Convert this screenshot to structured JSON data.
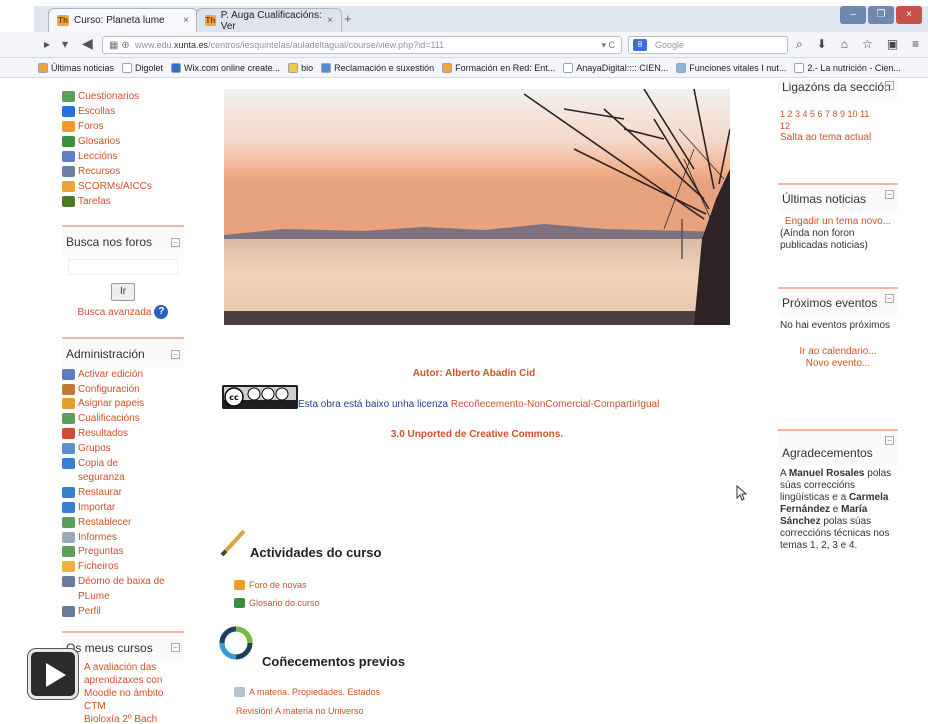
{
  "browser": {
    "tabs": [
      {
        "label": "Curso: Planeta lume",
        "active": true
      },
      {
        "label": "P. Auga Cualificacións: Ver",
        "active": false
      }
    ],
    "new_tab": "+",
    "window_buttons": [
      "–",
      "❐",
      "×"
    ],
    "url_prefix": "www.edu.",
    "url_host": "xunta.es",
    "url_path": "/centros/iesquintelas/auladeltagual/course/view.php?id=111",
    "search_placeholder": "Google",
    "bookmarks": [
      {
        "label": "Últimas noticias",
        "color": "#f0a53a"
      },
      {
        "label": "Digolet",
        "color": "#ffffff"
      },
      {
        "label": "Wix.com online create...",
        "color": "#2f6fd0"
      },
      {
        "label": "bio",
        "color": "#f2c94c"
      },
      {
        "label": "Reclamación e suxestión",
        "color": "#4a90d9"
      },
      {
        "label": "Formación en Red: Ent...",
        "color": "#f0a53a"
      },
      {
        "label": "AnayaDigital:::: CIEN...",
        "color": "#ffffff"
      },
      {
        "label": "Funciones vitales I nut...",
        "color": "#8fb3e0"
      },
      {
        "label": "2.- La nutrición - Cien...",
        "color": "#ffffff"
      }
    ]
  },
  "left": {
    "activities": [
      {
        "label": "Cuestionarios",
        "color": "#5aa05a"
      },
      {
        "label": "Escollas",
        "color": "#2a6fd6"
      },
      {
        "label": "Foros",
        "color": "#f09a2b"
      },
      {
        "label": "Glosarios",
        "color": "#3d8f3d"
      },
      {
        "label": "Leccións",
        "color": "#5b7fc9"
      },
      {
        "label": "Recursos",
        "color": "#6b7fa8"
      },
      {
        "label": "SCORMs/AICCs",
        "color": "#e8a63a"
      },
      {
        "label": "Tarefas",
        "color": "#4a7a2a"
      }
    ],
    "search_forums_title": "Busca nos foros",
    "search_button": "Ir",
    "advanced_search": "Busca avanzada",
    "admin_title": "Administración",
    "admin_items": [
      {
        "label": "Activar edición",
        "color": "#5a7fc0"
      },
      {
        "label": "Configuración",
        "color": "#c07a3a"
      },
      {
        "label": "Asignar papeis",
        "color": "#e0a030"
      },
      {
        "label": "Cualificacións",
        "color": "#5aa05a"
      },
      {
        "label": "Resultados",
        "color": "#d04a3a"
      },
      {
        "label": "Grupos",
        "color": "#5a8fd0"
      },
      {
        "label": "Copia de",
        "color": "#3a7fd0"
      },
      {
        "label": "seguranza",
        "color": ""
      },
      {
        "label": "Restaurar",
        "color": "#3a7fd0"
      },
      {
        "label": "Importar",
        "color": "#3a7fd0"
      },
      {
        "label": "Restablecer",
        "color": "#5aa05a"
      },
      {
        "label": "Informes",
        "color": "#9aaab8"
      },
      {
        "label": "Preguntas",
        "color": "#5aa05a"
      },
      {
        "label": "Ficheiros",
        "color": "#f0b040"
      },
      {
        "label": "Déomo de baixa de",
        "color": "#6a7a9a"
      },
      {
        "label": "PLume",
        "color": ""
      },
      {
        "label": "Perfil",
        "color": "#6a7a9a"
      }
    ],
    "my_courses_title": "Os meus cursos",
    "my_courses": [
      "A avaliación das",
      "aprendizaxes con",
      "Moodle no ámbito CTM",
      "Bioloxía 2º Bach"
    ]
  },
  "center": {
    "author": "Autor: Alberto Abadín Cid",
    "license_text": "Esta obra está baixo unha licenza",
    "license_link": "Recoñecemento-NonComercial-CompartirIgual",
    "license_link2": "3.0 Unported de Creative Commons.",
    "activities_title": "Actividades do curso",
    "activity_items": [
      {
        "label": "Foro de novas",
        "color": "#f09a2b"
      },
      {
        "label": "Glosario do curso",
        "color": "#3d8f3d"
      }
    ],
    "prior_title": "Coñecementos previos",
    "prior_items": [
      "A materia. Propiedades. Estados",
      "Revisión! A materia no Universo"
    ]
  },
  "right": {
    "links_title": "Ligazóns da sección",
    "section_numbers": "1 2 3 4 5 6 7 8 9 10 11",
    "section_numbers2": "12",
    "jump_current": "Salta ao tema actual",
    "news_title": "Últimas noticias",
    "add_topic": "Engadir un tema novo...",
    "no_news": "(Aínda non foron publicadas noticias)",
    "events_title": "Próximos eventos",
    "no_events": "No hai eventos próximos",
    "go_calendar": "Ir ao calendario...",
    "new_event": "Novo evento...",
    "thanks_title": "Agradecementos",
    "thanks_lines": [
      {
        "text": "A ",
        "bold": false
      },
      {
        "text": "Manuel Rosales",
        "bold": true
      },
      {
        "text": " polas súas correccións lingüísticas e a ",
        "bold": false
      },
      {
        "text": "Carmela Fernández",
        "bold": true
      },
      {
        "text": " e ",
        "bold": false
      },
      {
        "text": "María Sánchez",
        "bold": true
      },
      {
        "text": " polas súas correccións técnicas nos temas 1, 2, 3 e 4.",
        "bold": false
      }
    ]
  }
}
